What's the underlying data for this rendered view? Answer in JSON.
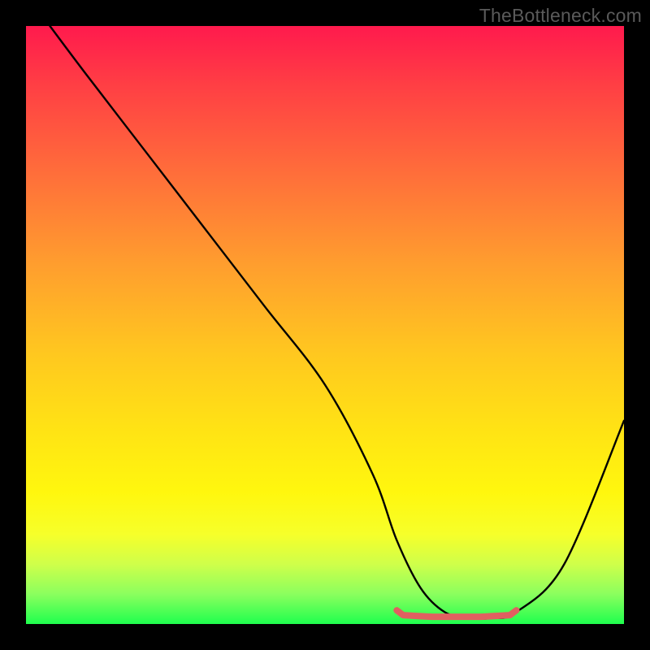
{
  "watermark": "TheBottleneck.com",
  "chart_data": {
    "type": "line",
    "title": "",
    "xlabel": "",
    "ylabel": "",
    "xlim": [
      0,
      100
    ],
    "ylim": [
      0,
      100
    ],
    "series": [
      {
        "name": "black-curve",
        "x": [
          4,
          10,
          20,
          30,
          40,
          50,
          58,
          62,
          66,
          70,
          74,
          78,
          82,
          90,
          100
        ],
        "values": [
          100,
          92,
          79,
          66,
          53,
          40,
          25,
          14,
          6,
          2,
          1,
          1,
          2,
          10,
          34
        ]
      }
    ],
    "flat_region": {
      "name": "red-flat-segment",
      "x_start": 62,
      "x_end": 82,
      "y": 1.2,
      "color": "#e06060"
    },
    "colors": {
      "curve": "#000000",
      "flat_segment": "#e06060",
      "gradient_top": "#ff1a4d",
      "gradient_bottom": "#1fff4e",
      "background": "#000000",
      "watermark": "#5a5a5a"
    }
  }
}
